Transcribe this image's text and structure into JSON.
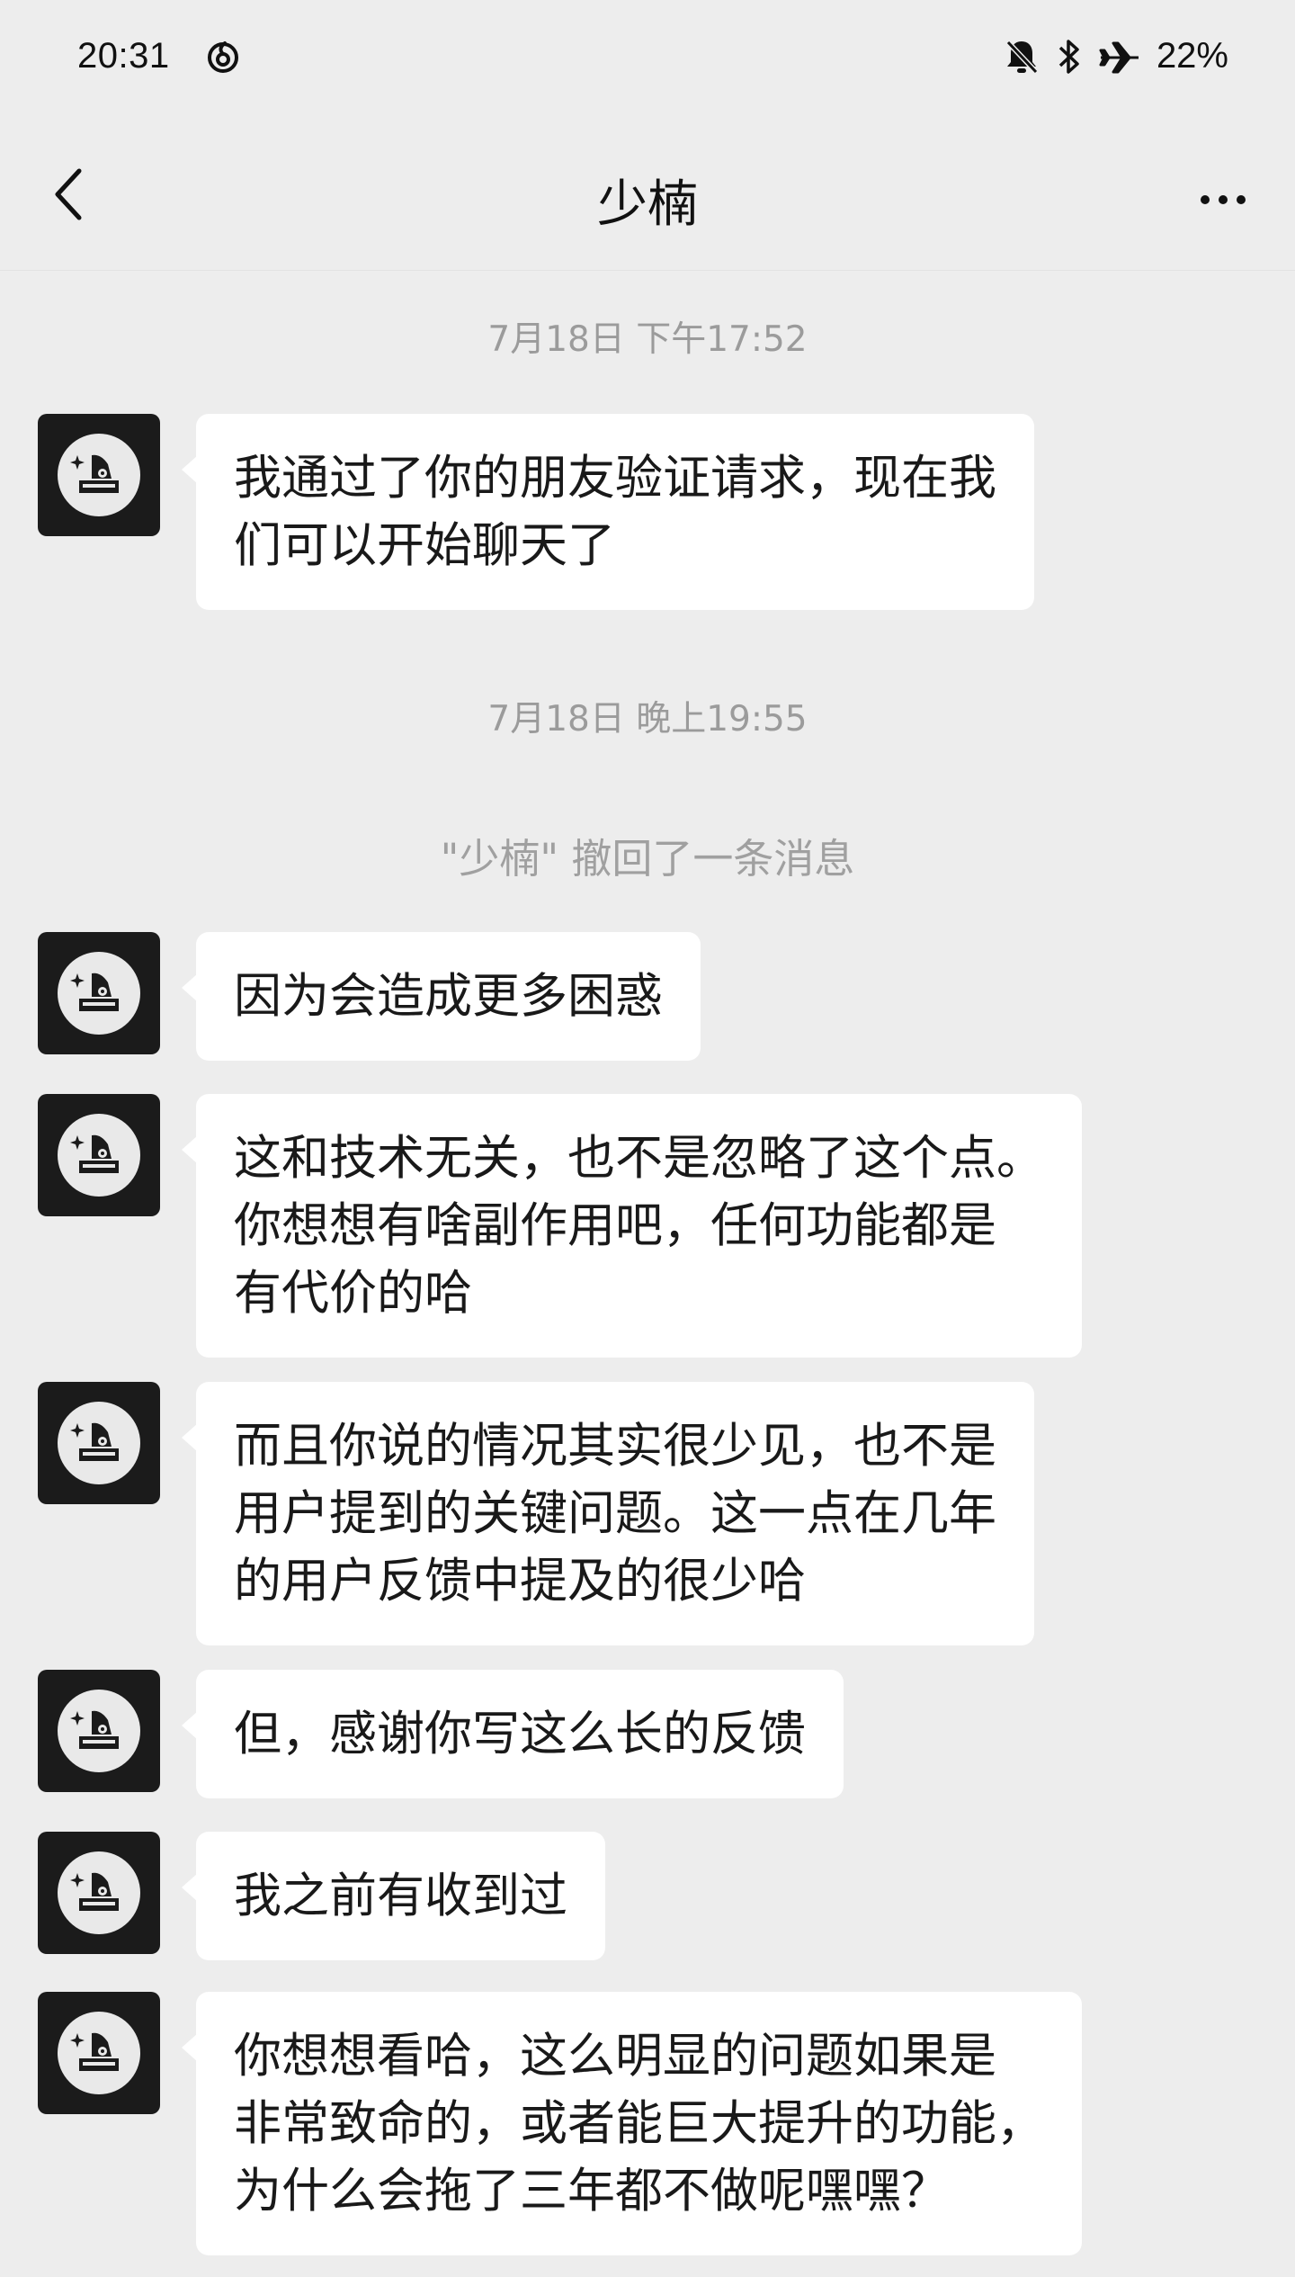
{
  "status_bar": {
    "time": "20:31",
    "app_icon": "netease-music-icon",
    "icons": [
      "mute-icon",
      "bluetooth-icon",
      "airplane-icon"
    ],
    "battery": "22%"
  },
  "nav": {
    "title": "少楠",
    "back_icon": "chevron-left-icon",
    "more_icon": "more-icon"
  },
  "timeline": {
    "ts1": "7月18日 下午17:52",
    "ts2": "7月18日 晚上19:55",
    "recall_notice": "\"少楠\" 撤回了一条消息"
  },
  "messages": [
    {
      "lines": [
        "我通过了你的朋友验证请求，现在我",
        "们可以开始聊天了"
      ]
    },
    {
      "lines": [
        "因为会造成更多困惑"
      ]
    },
    {
      "lines": [
        "这和技术无关，也不是忽略了这个点。",
        "你想想有啥副作用吧，任何功能都是",
        "有代价的哈"
      ]
    },
    {
      "lines": [
        "而且你说的情况其实很少见，也不是",
        "用户提到的关键问题。这一点在几年",
        "的用户反馈中提及的很少哈"
      ]
    },
    {
      "lines": [
        "但，感谢你写这么长的反馈"
      ]
    },
    {
      "lines": [
        "我之前有收到过"
      ]
    },
    {
      "lines": [
        "你想想看哈，这么明显的问题如果是",
        "非常致命的，或者能巨大提升的功能，",
        "为什么会拖了三年都不做呢嘿嘿？"
      ]
    }
  ],
  "colors": {
    "background": "#ededed",
    "bubble": "#ffffff",
    "text": "#191919",
    "timestamp": "#9b9b9b",
    "avatar_bg": "#1b1b1b"
  }
}
